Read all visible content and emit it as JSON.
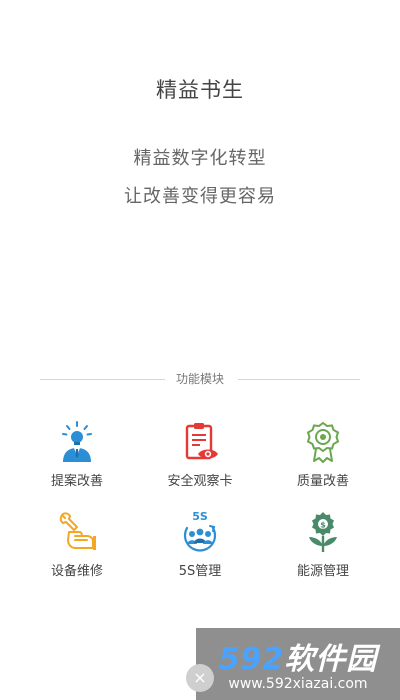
{
  "header": {
    "title": "精益书生",
    "slogan_line1": "精益数字化转型",
    "slogan_line2": "让改善变得更容易"
  },
  "section": {
    "title": "功能模块"
  },
  "modules": [
    {
      "label": "提案改善",
      "icon": "person-bulb-icon",
      "color": "#2b8fd6"
    },
    {
      "label": "安全观察卡",
      "icon": "clipboard-eye-icon",
      "color": "#e53935"
    },
    {
      "label": "质量改善",
      "icon": "quality-badge-icon",
      "color": "#6aa84f"
    },
    {
      "label": "设备维修",
      "icon": "wrench-hand-icon",
      "color": "#f5a623"
    },
    {
      "label": "5S管理",
      "icon": "5s-team-icon",
      "color": "#2b8fd6",
      "icon_text": "5S"
    },
    {
      "label": "能源管理",
      "icon": "energy-plant-icon",
      "color": "#4a8a6a"
    }
  ],
  "watermark": {
    "brand_num": "592",
    "brand_text": "软件园",
    "url": "www.592xiazai.com",
    "close": "×"
  }
}
